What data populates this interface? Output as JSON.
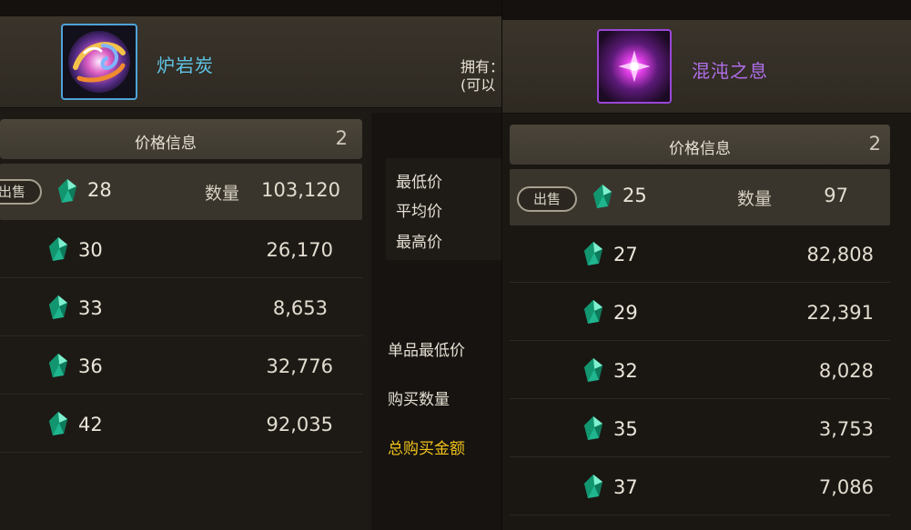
{
  "left": {
    "item_name": "炉岩炭",
    "owned_label_line1": "拥有：",
    "owned_label_line2": "(可以",
    "price_header": "价格信息",
    "price_header_count": "2",
    "sell_label": "出售",
    "qty_label": "数量",
    "rows": [
      {
        "price": "28",
        "qty": "103,120"
      },
      {
        "price": "30",
        "qty": "26,170"
      },
      {
        "price": "33",
        "qty": "8,653"
      },
      {
        "price": "36",
        "qty": "32,776"
      },
      {
        "price": "42",
        "qty": "92,035"
      }
    ],
    "stats": {
      "min_label": "最低价",
      "avg_label": "平均价",
      "max_label": "最高价"
    },
    "purchase": {
      "unit_min_label": "单品最低价",
      "buy_qty_label": "购买数量",
      "total_label": "总购买金额"
    }
  },
  "right": {
    "item_name": "混沌之息",
    "price_header": "价格信息",
    "price_header_count": "2",
    "sell_label": "出售",
    "qty_label": "数量",
    "rows": [
      {
        "price": "25",
        "qty": "97"
      },
      {
        "price": "27",
        "qty": "82,808"
      },
      {
        "price": "29",
        "qty": "22,391"
      },
      {
        "price": "32",
        "qty": "8,028"
      },
      {
        "price": "35",
        "qty": "3,753"
      },
      {
        "price": "37",
        "qty": "7,086"
      }
    ]
  },
  "icons": {
    "left_item_icon": "swirl-orb-icon",
    "right_item_icon": "purple-sparkle-icon",
    "currency_icon": "green-gem-icon"
  },
  "colors": {
    "left_item_name": "#5fc4e6",
    "right_item_name": "#b06ee8",
    "total_label": "#f2c21a"
  }
}
